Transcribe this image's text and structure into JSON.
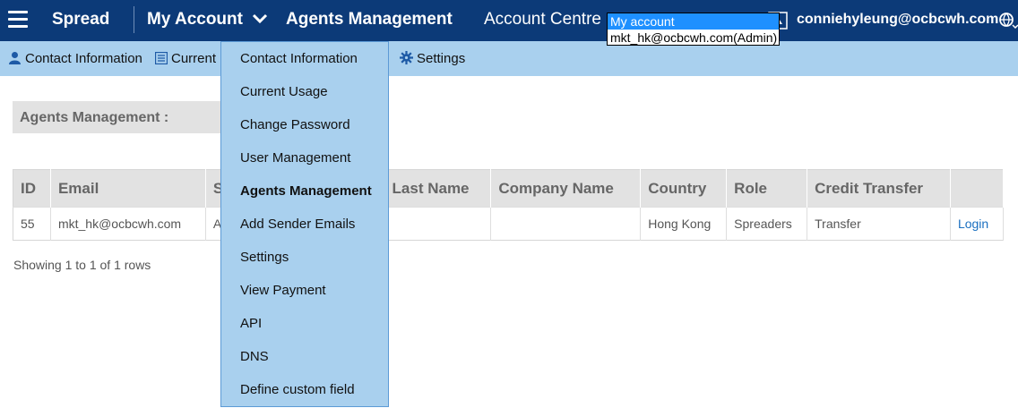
{
  "topbar": {
    "brand": "Spread",
    "my_account": "My Account",
    "agents_management": "Agents Management",
    "account_centre_label": "Account Centre :",
    "account_options": [
      "My account",
      "mkt_hk@ocbcwh.com(Admin)"
    ],
    "account_selected": "My account",
    "user_email": "conniehyleung@ocbcwh.com"
  },
  "subnav": {
    "contact_information": "Contact Information",
    "current_usage": "Current U",
    "settings": "Settings"
  },
  "section": {
    "title": "Agents Management :"
  },
  "table": {
    "headers": [
      "ID",
      "Email",
      "S",
      "",
      "Last Name",
      "Company Name",
      "Country",
      "Role",
      "Credit Transfer",
      ""
    ],
    "rows": [
      [
        "55",
        "mkt_hk@ocbcwh.com",
        "A",
        "",
        "",
        "",
        "Hong Kong",
        "Spreaders",
        "Transfer",
        "Login"
      ]
    ]
  },
  "pagination": {
    "showing": "Showing 1 to 1 of 1 rows"
  },
  "menu": {
    "items": [
      "Contact Information",
      "Current Usage",
      "Change Password",
      "User Management",
      "Agents Management",
      "Add Sender Emails",
      "Settings",
      "View Payment",
      "API",
      "DNS",
      "Define custom field"
    ],
    "active_item": "Agents Management"
  },
  "colors": {
    "topbar": "#0c3a78",
    "subnav": "#a9d0ee",
    "link": "#1a6fc0",
    "selected_option": "#1e90ff"
  },
  "icons": [
    "menu-icon",
    "chevron-down-icon",
    "bell-icon",
    "globe-icon",
    "user-icon",
    "list-icon",
    "gear-icon"
  ]
}
